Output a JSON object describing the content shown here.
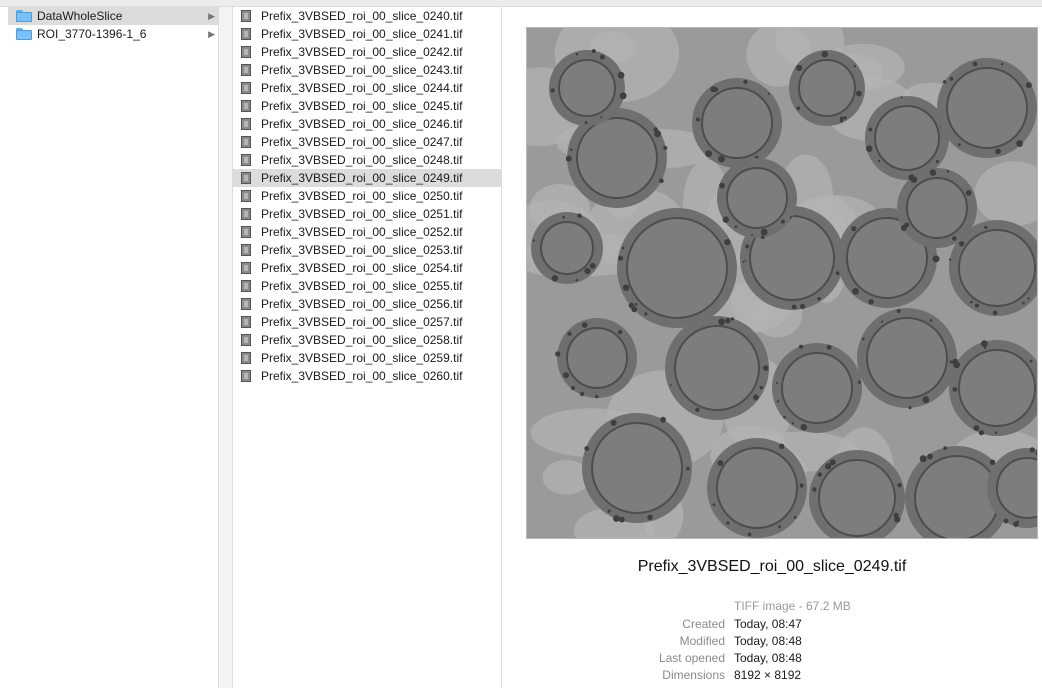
{
  "sidebar": {
    "items": [
      {
        "label": "DataWholeSlice",
        "selected": true
      },
      {
        "label": "ROI_3770-1396-1_6",
        "selected": false
      }
    ]
  },
  "files": {
    "items": [
      "Prefix_3VBSED_roi_00_slice_0240.tif",
      "Prefix_3VBSED_roi_00_slice_0241.tif",
      "Prefix_3VBSED_roi_00_slice_0242.tif",
      "Prefix_3VBSED_roi_00_slice_0243.tif",
      "Prefix_3VBSED_roi_00_slice_0244.tif",
      "Prefix_3VBSED_roi_00_slice_0245.tif",
      "Prefix_3VBSED_roi_00_slice_0246.tif",
      "Prefix_3VBSED_roi_00_slice_0247.tif",
      "Prefix_3VBSED_roi_00_slice_0248.tif",
      "Prefix_3VBSED_roi_00_slice_0249.tif",
      "Prefix_3VBSED_roi_00_slice_0250.tif",
      "Prefix_3VBSED_roi_00_slice_0251.tif",
      "Prefix_3VBSED_roi_00_slice_0252.tif",
      "Prefix_3VBSED_roi_00_slice_0253.tif",
      "Prefix_3VBSED_roi_00_slice_0254.tif",
      "Prefix_3VBSED_roi_00_slice_0255.tif",
      "Prefix_3VBSED_roi_00_slice_0256.tif",
      "Prefix_3VBSED_roi_00_slice_0257.tif",
      "Prefix_3VBSED_roi_00_slice_0258.tif",
      "Prefix_3VBSED_roi_00_slice_0259.tif",
      "Prefix_3VBSED_roi_00_slice_0260.tif"
    ],
    "selected": "Prefix_3VBSED_roi_00_slice_0249.tif"
  },
  "preview": {
    "filename": "Prefix_3VBSED_roi_00_slice_0249.tif",
    "kind": "TIFF image - 67.2 MB",
    "meta": [
      {
        "key": "Created",
        "value": "Today, 08:47"
      },
      {
        "key": "Modified",
        "value": "Today, 08:48"
      },
      {
        "key": "Last opened",
        "value": "Today, 08:48"
      },
      {
        "key": "Dimensions",
        "value": "8192 × 8192"
      }
    ]
  },
  "colors": {
    "folder": "#77c1f6",
    "selection": "#dcdcdc",
    "preview_bg": "#8d8d8d"
  },
  "icons": {
    "folder": "folder-icon",
    "file": "tiff-file-icon",
    "chevron": "chevron-right-icon"
  }
}
